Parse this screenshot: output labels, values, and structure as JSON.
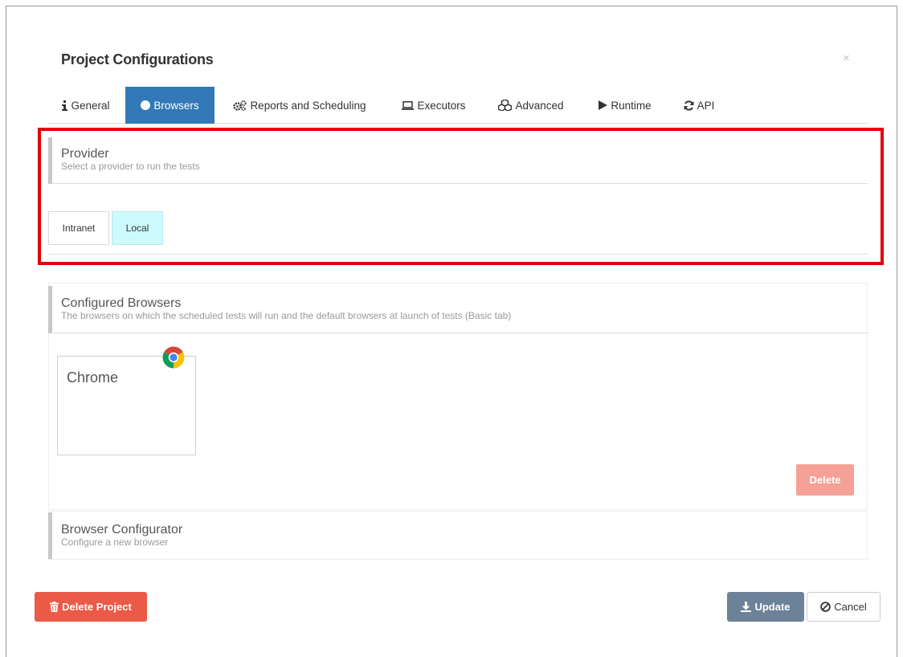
{
  "dialog": {
    "title": "Project Configurations",
    "close_symbol": "×"
  },
  "tabs": [
    {
      "label": "General",
      "icon": "info-icon"
    },
    {
      "label": "Browsers",
      "icon": "globe-icon",
      "active": true
    },
    {
      "label": "Reports and Scheduling",
      "icon": "gears-icon"
    },
    {
      "label": "Executors",
      "icon": "laptop-icon"
    },
    {
      "label": "Advanced",
      "icon": "cubes-icon"
    },
    {
      "label": "Runtime",
      "icon": "play-icon"
    },
    {
      "label": "API",
      "icon": "refresh-icon"
    }
  ],
  "provider": {
    "heading": "Provider",
    "subheading": "Select a provider to run the tests",
    "options": [
      "Intranet",
      "Local"
    ],
    "selected": "Local"
  },
  "configured_browsers": {
    "heading": "Configured Browsers",
    "subheading": "The browsers on which the scheduled tests will run and the default browsers at launch of tests (Basic tab)",
    "items": [
      {
        "name": "Chrome",
        "icon": "chrome-icon"
      }
    ],
    "delete_label": "Delete"
  },
  "browser_configurator": {
    "heading": "Browser Configurator",
    "subheading": "Configure a new browser"
  },
  "footer": {
    "delete_project_label": "Delete Project",
    "update_label": "Update",
    "cancel_label": "Cancel"
  },
  "colors": {
    "active_tab": "#3379b7",
    "highlight_border": "#e3000b",
    "selected_provider": "#cdfbfd",
    "danger": "#ea5a47",
    "danger_light": "#f6a197",
    "update": "#6c8299"
  }
}
